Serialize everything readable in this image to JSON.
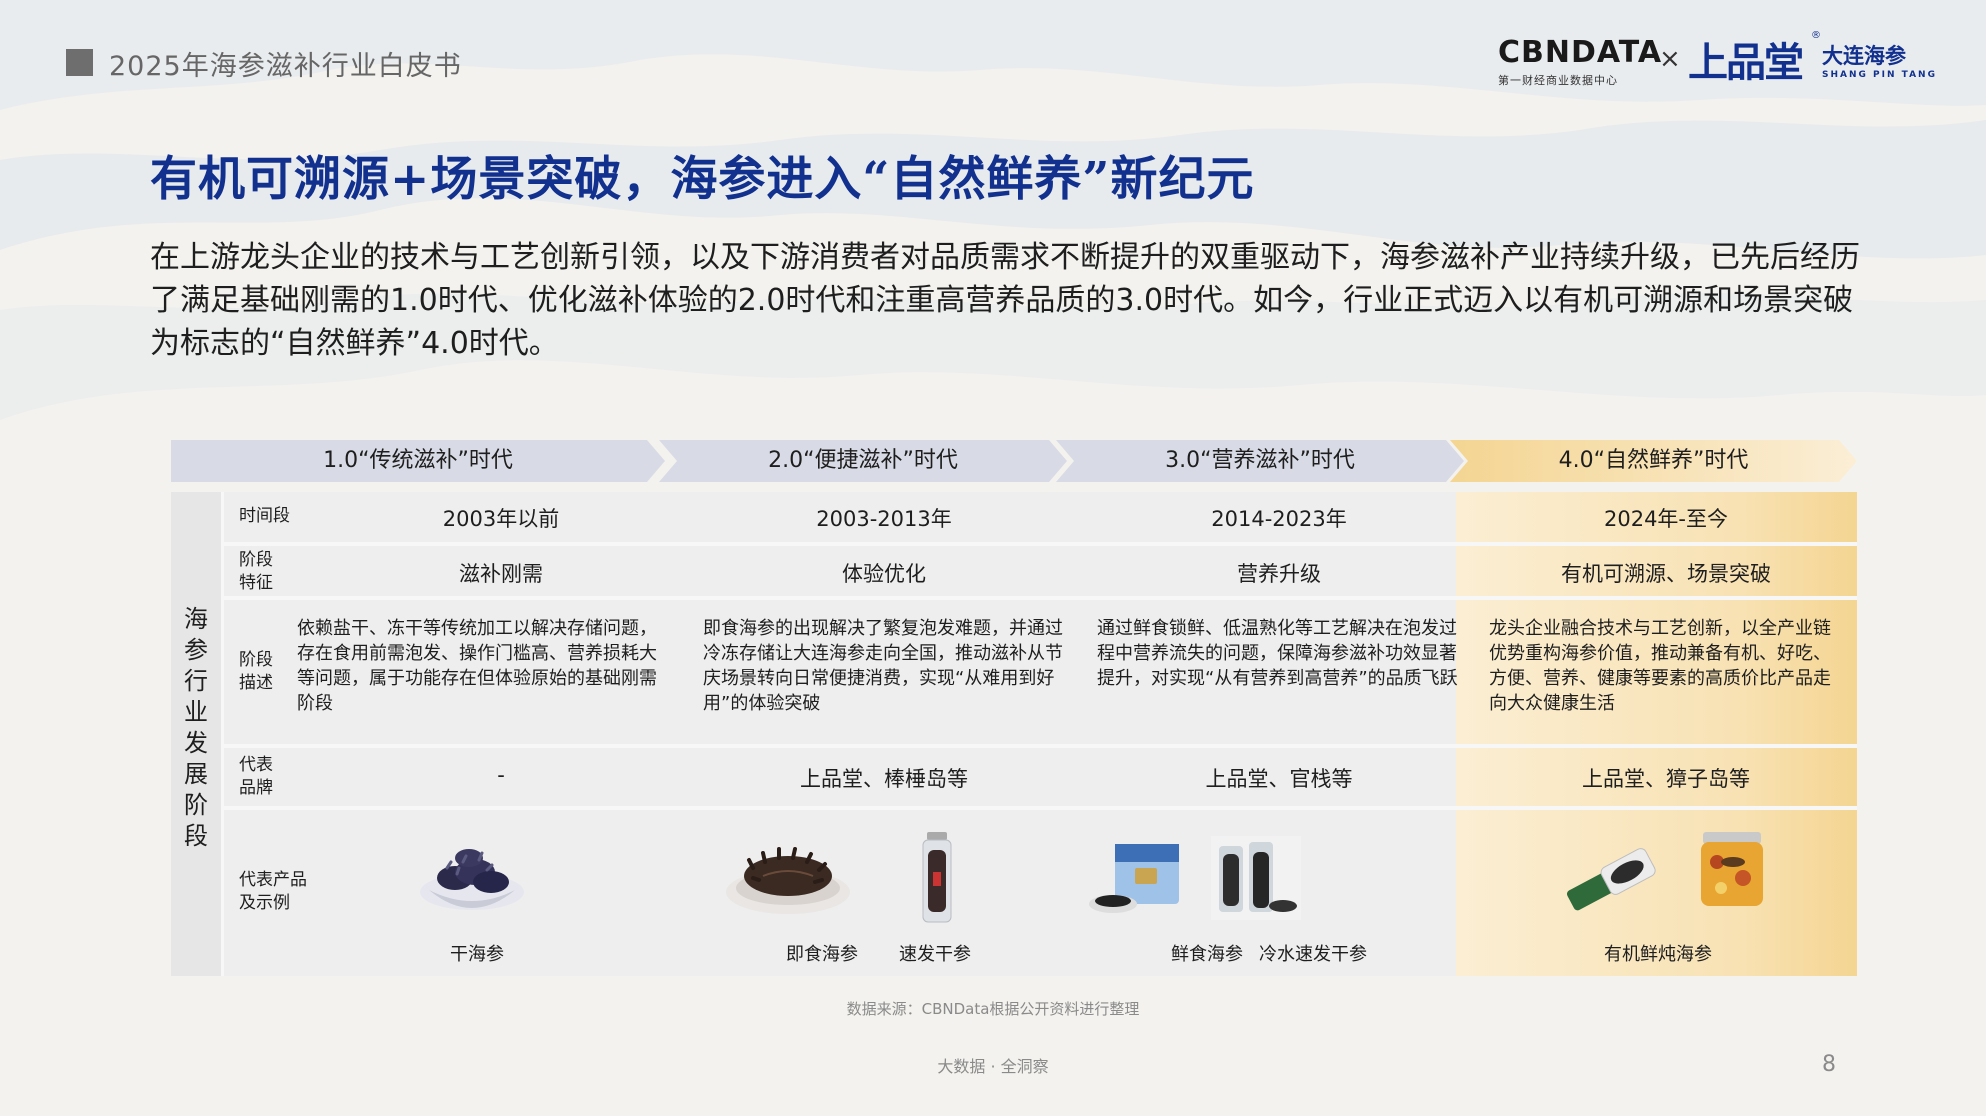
{
  "header": {
    "report_title": "2025年海参滋补行业白皮书",
    "cbn_logo": "CBNDATA",
    "cbn_sub": "第一财经商业数据中心",
    "times": "×",
    "spt_logo": "上品堂",
    "spt_reg": "®",
    "spt_cn": "大连海参",
    "spt_en": "SHANG PIN TANG"
  },
  "title": "有机可溯源+场景突破，海参进入“自然鲜养”新纪元",
  "intro": "在上游龙头企业的技术与工艺创新引领，以及下游消费者对品质需求不断提升的双重驱动下，海参滋补产业持续升级，已先后经历了满足基础刚需的1.0时代、优化滋补体验的2.0时代和注重高营养品质的3.0时代。如今，行业正式迈入以有机可溯源和场景突破为标志的“自然鲜养”4.0时代。",
  "table": {
    "side_label": "海参行业发展阶段",
    "row_labels": {
      "period": "时间段",
      "feature": "阶段特征",
      "description": "阶段描述",
      "brands": "代表品牌",
      "products": "代表产品及示例"
    },
    "eras": [
      {
        "header": "1.0“传统滋补”时代",
        "period": "2003年以前",
        "feature": "滋补刚需",
        "description": "依赖盐干、冻干等传统加工以解决存储问题，存在食用前需泡发、操作门槛高、营养损耗大等问题，属于功能存在但体验原始的基础刚需阶段",
        "brands": "-",
        "products": [
          "干海参"
        ]
      },
      {
        "header": "2.0“便捷滋补”时代",
        "period": "2003-2013年",
        "feature": "体验优化",
        "description": "即食海参的出现解决了繁复泡发难题，并通过冷冻存储让大连海参走向全国，推动滋补从节庆场景转向日常便捷消费，实现“从难用到好用”的体验突破",
        "brands": "上品堂、棒棰岛等",
        "products": [
          "即食海参",
          "速发干参"
        ]
      },
      {
        "header": "3.0“营养滋补”时代",
        "period": "2014-2023年",
        "feature": "营养升级",
        "description": "通过鲜食锁鲜、低温熟化等工艺解决在泡发过程中营养流失的问题，保障海参滋补功效显著提升，对实现“从有营养到高营养”的品质飞跃",
        "brands": "上品堂、官栈等",
        "products": [
          "鲜食海参",
          "冷水速发干参"
        ]
      },
      {
        "header": "4.0“自然鲜养”时代",
        "period": "2024年-至今",
        "feature": "有机可溯源、场景突破",
        "description": "龙头企业融合技术与工艺创新，以全产业链优势重构海参价值，推动兼备有机、好吃、方便、营养、健康等要素的高质价比产品走向大众健康生活",
        "brands": "上品堂、獐子岛等",
        "products": [
          "有机鲜炖海参"
        ]
      }
    ]
  },
  "source": "数据来源：CBNData根据公开资料进行整理",
  "footer": "大数据 · 全洞察",
  "page_number": "8",
  "colors": {
    "title_blue": "#12318f",
    "arrow_gray": "#d8dbe5",
    "arrow_gold": "#f6dca4",
    "gold_column": "#f8e2b4"
  }
}
